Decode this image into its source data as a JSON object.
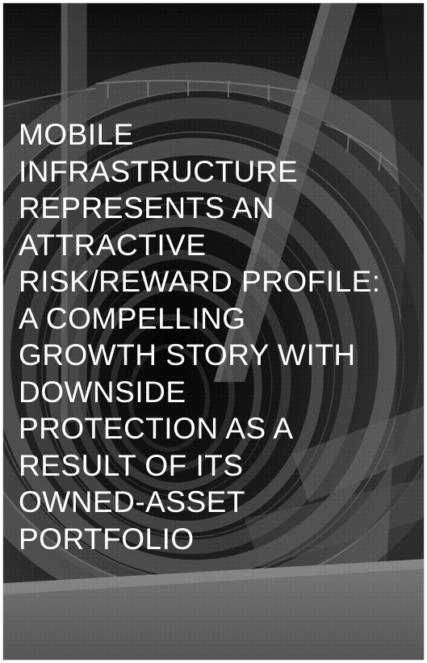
{
  "headline": {
    "lines": [
      "MOBILE",
      "INFRASTRUCTURE",
      "REPRESENTS AN",
      "ATTRACTIVE",
      "RISK/REWARD PROFILE:",
      "A COMPELLING",
      "GROWTH STORY WITH",
      "DOWNSIDE",
      "PROTECTION AS A",
      "RESULT OF ITS",
      "OWNED-ASSET",
      "PORTFOLIO"
    ]
  },
  "background": {
    "subject": "spiral parking garage ramp, black and white photograph",
    "colors": {
      "dark": "#141414",
      "mid": "#5a5a5a",
      "light": "#b5b5b5",
      "text": "#ffffff"
    }
  }
}
